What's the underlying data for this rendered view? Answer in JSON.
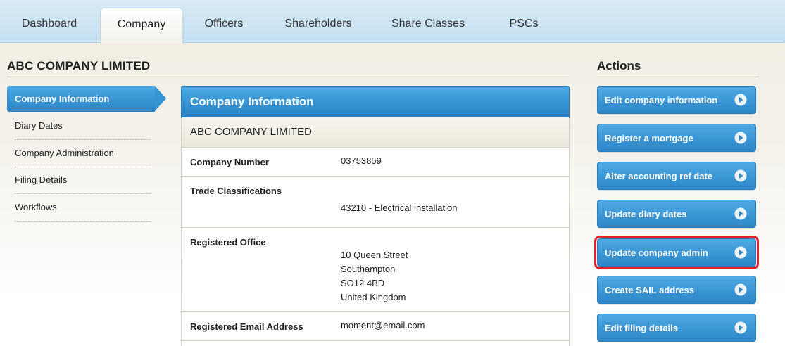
{
  "tabs": [
    {
      "label": "Dashboard",
      "active": false
    },
    {
      "label": "Company",
      "active": true
    },
    {
      "label": "Officers",
      "active": false
    },
    {
      "label": "Shareholders",
      "active": false
    },
    {
      "label": "Share Classes",
      "active": false
    },
    {
      "label": "PSCs",
      "active": false
    }
  ],
  "company": {
    "name": "ABC COMPANY LIMITED"
  },
  "sidebar": {
    "items": [
      {
        "label": "Company Information",
        "active": true
      },
      {
        "label": "Diary Dates",
        "active": false
      },
      {
        "label": "Company Administration",
        "active": false
      },
      {
        "label": "Filing Details",
        "active": false
      },
      {
        "label": "Workflows",
        "active": false
      }
    ]
  },
  "panel": {
    "title": "Company Information",
    "subtitle": "ABC COMPANY LIMITED",
    "rows": [
      {
        "label": "Company Number",
        "value": "03753859"
      },
      {
        "label": "Trade Classifications",
        "value": "43210 - Electrical installation"
      },
      {
        "label": "Registered Office",
        "lines": [
          "10 Queen Street",
          "Southampton",
          "SO12 4BD",
          "United Kingdom"
        ]
      },
      {
        "label": "Registered Email Address",
        "value": "moment@email.com"
      }
    ]
  },
  "actions": {
    "title": "Actions",
    "buttons": [
      {
        "label": "Edit company information",
        "highlighted": false
      },
      {
        "label": "Register a mortgage",
        "highlighted": false
      },
      {
        "label": "Alter accounting ref date",
        "highlighted": false
      },
      {
        "label": "Update diary dates",
        "highlighted": false
      },
      {
        "label": "Update company admin",
        "highlighted": true
      },
      {
        "label": "Create SAIL address",
        "highlighted": false
      },
      {
        "label": "Edit filing details",
        "highlighted": false
      }
    ],
    "icon": "circle-play-icon"
  },
  "colors": {
    "accent": "#2b85c8",
    "highlight": "#e0202a",
    "tabbar": "#c4e0f2"
  }
}
